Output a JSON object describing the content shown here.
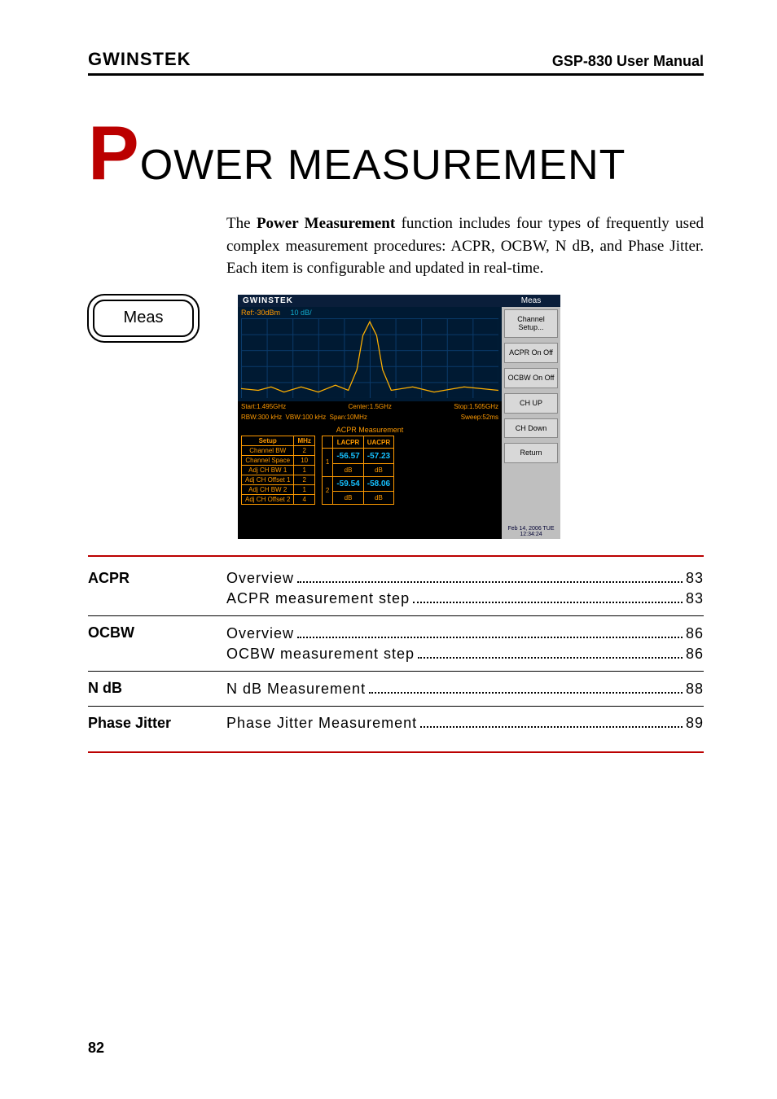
{
  "header": {
    "brand": "GWINSTEK",
    "manual": "GSP-830 User Manual"
  },
  "title": {
    "cap": "P",
    "rest": "OWER MEASUREMENT"
  },
  "intro": {
    "p1a": "The ",
    "p1b": "Power Measurement",
    "p1c": " function includes four types of frequently used complex measurement procedures: ACPR, OCBW, N dB, and Phase Jitter. Each item is configurable and updated in real-time."
  },
  "keycap": "Meas",
  "scr": {
    "brand": "GWINSTEK",
    "ref": "Ref:-30dBm",
    "div": "10 dB/",
    "start": "Start:1.495GHz",
    "center": "Center:1.5GHz",
    "stop": "Stop:1.505GHz",
    "rbw": "RBW:300 kHz",
    "vbw": "VBW:100 kHz",
    "span": "Span:10MHz",
    "sweep": "Sweep:52ms",
    "meas_title": "ACPR Measurement",
    "setup_hdr": "Setup",
    "mhz_hdr": "MHz",
    "rows": [
      {
        "k": "Channel BW",
        "v": "2"
      },
      {
        "k": "Channel Space",
        "v": "10"
      },
      {
        "k": "Adj CH BW 1",
        "v": "1"
      },
      {
        "k": "Adj CH Offset 1",
        "v": "2"
      },
      {
        "k": "Adj CH BW 2",
        "v": "1"
      },
      {
        "k": "Adj CH Offset 2",
        "v": "4"
      }
    ],
    "lacpr": "LACPR",
    "uacpr": "UACPR",
    "r1": {
      "n": "1",
      "l": "-56.57",
      "u": "-57.23"
    },
    "r2": {
      "n": "2",
      "l": "-59.54",
      "u": "-58.06"
    },
    "db": "dB",
    "menu_hd": "Meas",
    "menu": [
      "Channel\nSetup...",
      "ACPR\nOn    Off",
      "OCBW\nOn    Off",
      "CH UP",
      "CH Down",
      "Return"
    ],
    "stamp": "Feb 14, 2006\nTUE 12:34:24"
  },
  "toc": [
    {
      "label": "ACPR",
      "lines": [
        {
          "t": "Overview",
          "p": "83"
        },
        {
          "t": "ACPR measurement step",
          "p": "83"
        }
      ]
    },
    {
      "label": "OCBW",
      "lines": [
        {
          "t": "Overview",
          "p": "86"
        },
        {
          "t": "OCBW measurement step",
          "p": "86"
        }
      ]
    },
    {
      "label": "N dB",
      "lines": [
        {
          "t": "N dB Measurement",
          "p": "88"
        }
      ]
    },
    {
      "label": "Phase Jitter",
      "lines": [
        {
          "t": "Phase Jitter Measurement",
          "p": "89"
        }
      ]
    }
  ],
  "page_number": "82"
}
